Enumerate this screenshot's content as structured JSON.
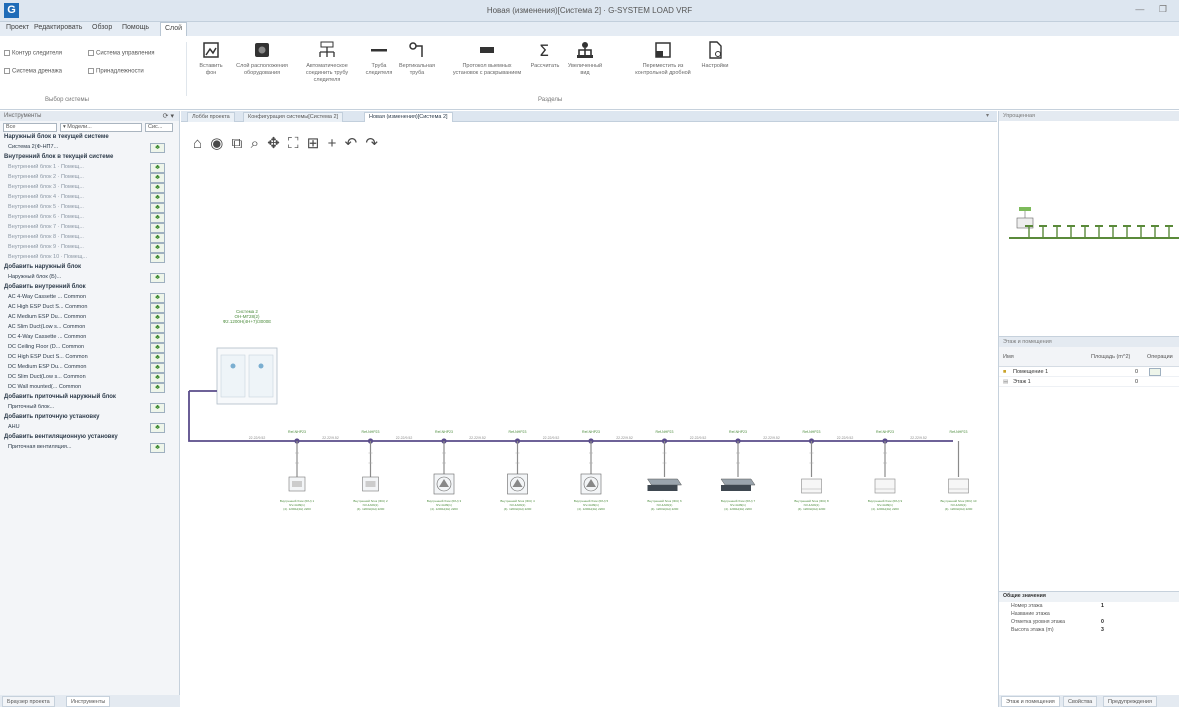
{
  "title_bar": {
    "logo": "G",
    "title": "Новая (изменения)[Система 2] · G-SYSTEM LOAD VRF",
    "controls": "— ❐"
  },
  "menu": {
    "items": [
      "Проект",
      "Редактировать",
      "Обзор",
      "Помощь",
      "Слой"
    ],
    "active_index": 4
  },
  "ribbon": {
    "checks": [
      "Контур следителя",
      "Система управления",
      "Система дренажа",
      "Принадлежности"
    ],
    "group_label": "Выбор системы",
    "buttons": [
      {
        "label": "Вставить фон",
        "icon": "insert-background-icon"
      },
      {
        "label": "Слой расположения оборудования",
        "icon": "equipment-layer-icon"
      },
      {
        "label": "Автоматическое соединить трубу следителя",
        "icon": "auto-pipe-icon"
      },
      {
        "label": "Труба следителя",
        "icon": "pipe-icon"
      },
      {
        "label": "Вертикальная труба",
        "icon": "vertical-pipe-icon"
      },
      {
        "label": "Протокол выемных установок с раскрыванием",
        "icon": "protocol-icon"
      },
      {
        "label": "Рассчитать",
        "icon": "calculate-icon"
      },
      {
        "label": "Увеличенный вид",
        "icon": "enlarged-view-icon"
      },
      {
        "label": "Переместить из контрольной дробной",
        "icon": "move-icon"
      },
      {
        "label": "Настройки",
        "icon": "settings-icon"
      }
    ],
    "group_label_2": "Разделы"
  },
  "left_panel": {
    "header": "Инструменты",
    "header_icons": "⟳ ▾",
    "filter_1": "Все",
    "filter_2": "▾ Модели...",
    "filter_3": "Сис...",
    "groups": [
      {
        "title": "Наружный блок в текущей системе",
        "items": [
          {
            "text": "Система 2(Ф-НП7...",
            "dim": false
          }
        ]
      },
      {
        "title": "Внутренний блок в текущей системе",
        "items": [
          {
            "text": "Внутренний блок 1 · Помещ...",
            "dim": true
          },
          {
            "text": "Внутренний блок 2 · Помещ...",
            "dim": true
          },
          {
            "text": "Внутренний блок 3 · Помещ...",
            "dim": true
          },
          {
            "text": "Внутренний блок 4 · Помещ...",
            "dim": true
          },
          {
            "text": "Внутренний блок 5 · Помещ...",
            "dim": true
          },
          {
            "text": "Внутренний блок 6 · Помещ...",
            "dim": true
          },
          {
            "text": "Внутренний блок 7 · Помещ...",
            "dim": true
          },
          {
            "text": "Внутренний блок 8 · Помещ...",
            "dim": true
          },
          {
            "text": "Внутренний блок 9 · Помещ...",
            "dim": true
          },
          {
            "text": "Внутренний блок 10 · Помещ...",
            "dim": true
          }
        ]
      },
      {
        "title": "Добавить наружный блок",
        "items": [
          {
            "text": "Наружный блок (Б)...",
            "dim": false
          }
        ]
      },
      {
        "title": "Добавить внутренний блок",
        "items": [
          {
            "text": "AC 4-Way Cassette ... Common",
            "dim": false
          },
          {
            "text": "AC High ESP Duct S... Common",
            "dim": false
          },
          {
            "text": "AC Medium ESP Du... Common",
            "dim": false
          },
          {
            "text": "AC Slim Duct(Low s... Common",
            "dim": false
          },
          {
            "text": "DC 4-Way Cassette ... Common",
            "dim": false
          },
          {
            "text": "DC Ceiling Floor (D... Common",
            "dim": false
          },
          {
            "text": "DC High ESP Duct S... Common",
            "dim": false
          },
          {
            "text": "DC Medium ESP Du... Common",
            "dim": false
          },
          {
            "text": "DC Slim Duct(Low s... Common",
            "dim": false
          },
          {
            "text": "DC Wall mounted(... Common",
            "dim": false
          }
        ]
      },
      {
        "title": "Добавить приточный наружный блок",
        "items": [
          {
            "text": "Приточный блок...",
            "dim": false
          }
        ]
      },
      {
        "title": "Добавить приточную установку",
        "items": [
          {
            "text": "AHU",
            "dim": false
          }
        ]
      },
      {
        "title": "Добавить вентиляционную установку",
        "items": [
          {
            "text": "Приточная вентиляция...",
            "dim": false
          }
        ]
      }
    ],
    "bottom_tabs": [
      "Браузер проекта",
      "Инструменты"
    ]
  },
  "doc_tabs": [
    {
      "label": "Лобби проекта",
      "active": false
    },
    {
      "label": "Конфигурация системы[Система 2]",
      "active": false
    },
    {
      "label": "Новая (изменения)[Система 2]",
      "active": true
    }
  ],
  "canvas": {
    "toolbar_icons": [
      "⌂",
      "◉",
      "⧉",
      "⌕",
      "✥",
      "⛶",
      "⊞",
      "+",
      "↶",
      "↷"
    ],
    "outdoor_label": [
      "Система 2",
      "ОН-МГ28(2)",
      "Ф2.1200Н(4Н+7)/3000Е"
    ],
    "segment_label": "22.22/9.52",
    "node_label": "Ref-NHP23",
    "indoor_units": [
      {
        "type": "small",
        "caption": [
          "Внутренний блок (IDU) 1",
          "NV-4A09(1)",
          "(4). 1200Н(4Н) 2200"
        ]
      },
      {
        "type": "small",
        "caption": [
          "Внутренний блок (IDU) 2",
          "NV-4A09(1)",
          "(4). 1200Н(4Н) 2200"
        ]
      },
      {
        "type": "fan",
        "caption": [
          "Внутренний блок (IDU) 3",
          "NV-4A09(1)",
          "(4). 1200Н(4Н) 2200"
        ]
      },
      {
        "type": "fan",
        "caption": [
          "Внутренний блок (IDU) 4",
          "NV-4A09(1)",
          "(4). 1200Н(4Н) 2200"
        ]
      },
      {
        "type": "fan",
        "caption": [
          "Внутренний блок (IDU) 5",
          "NV-4A09(1)",
          "(4). 1200Н(4Н) 2200"
        ]
      },
      {
        "type": "duct",
        "caption": [
          "Внутренний блок (IDU) 6",
          "NV-4A09(1)",
          "(4). 1200Н(4Н) 2200"
        ]
      },
      {
        "type": "duct",
        "caption": [
          "Внутренний блок (IDU) 7",
          "NV-4A09(1)",
          "(4). 1200Н(4Н) 2200"
        ]
      },
      {
        "type": "box",
        "caption": [
          "Внутренний блок (IDU) 8",
          "NV-4A09(1)",
          "(4). 1200Н(4Н) 2200"
        ]
      },
      {
        "type": "box",
        "caption": [
          "Внутренний блок (IDU) 9",
          "NV-4A09(1)",
          "(4). 1200Н(4Н) 2200"
        ]
      },
      {
        "type": "box",
        "caption": [
          "Внутренний блок (IDU) 10",
          "NV-4A09(1)",
          "(4). 1200Н(4Н) 2200"
        ]
      }
    ]
  },
  "right_panel": {
    "preview_title": "Упрощенная",
    "floors_title": "Этаж и помещения",
    "floor_columns": [
      "Имя",
      "Площадь (m^2)",
      "Операции"
    ],
    "floor_rows": [
      {
        "name": "Помещение 1",
        "area": "0"
      },
      {
        "name": "Этаж 1",
        "area": "0"
      }
    ],
    "props_title": "Общие значения",
    "props": [
      {
        "label": "Номер этажа",
        "value": "1"
      },
      {
        "label": "Название этажа",
        "value": ""
      },
      {
        "label": "Отметка уровня этажа",
        "value": "0"
      },
      {
        "label": "Высота этажа (m)",
        "value": "3"
      }
    ],
    "bottom_tabs": [
      "Этаж и помещения",
      "Свойства",
      "Предупреждения"
    ]
  },
  "colors": {
    "pipe": "#5a4c8a",
    "accent": "#1f6cb8",
    "add_green": "#3b8a2e"
  }
}
